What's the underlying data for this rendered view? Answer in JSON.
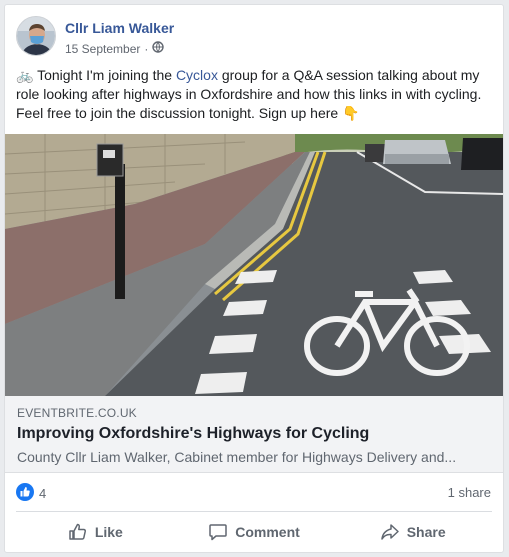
{
  "post": {
    "author": "Cllr Liam Walker",
    "date": "15 September",
    "separator": "·",
    "privacy_icon": "globe-icon",
    "text_prefix": "🚲 Tonight I'm joining the ",
    "text_link": "Cyclox",
    "text_suffix": " group for a Q&A session talking about my role looking after highways in Oxfordshire and how this links in with cycling. Feel free to join the discussion tonight. Sign up here 👇"
  },
  "link_preview": {
    "domain": "EVENTBRITE.CO.UK",
    "title": "Improving Oxfordshire's Highways for Cycling",
    "description": "County Cllr Liam Walker, Cabinet member for Highways Delivery and..."
  },
  "stats": {
    "like_count": "4",
    "shares": "1 share"
  },
  "actions": {
    "like": "Like",
    "comment": "Comment",
    "share": "Share"
  },
  "colors": {
    "author_link": "#385898",
    "like_blue": "#1877f2"
  }
}
